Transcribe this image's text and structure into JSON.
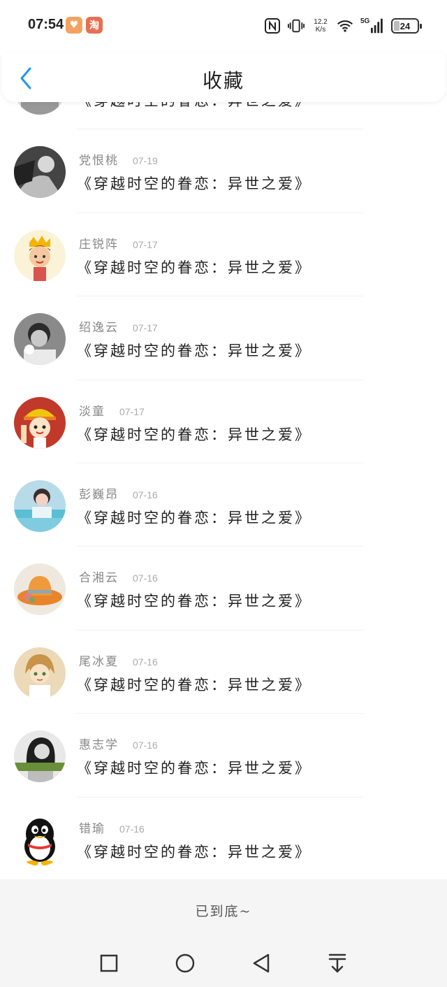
{
  "status_bar": {
    "time": "07:54",
    "app_badges": [
      "heart-app-icon",
      "taobao-icon"
    ],
    "taobao_char": "淘",
    "network_speed_value": "12.2",
    "network_speed_unit": "K/s",
    "network_type": "5G",
    "battery_level": "24",
    "battery_fill_percent": 24
  },
  "header": {
    "title": "收藏",
    "back_icon": "chevron-left-icon",
    "accent_color": "#2196f3"
  },
  "favorites": [
    {
      "author": "",
      "date": "",
      "title": "《穿越时空的眷恋：异世之爱》"
    },
    {
      "author": "党恨桃",
      "date": "07-19",
      "title": "《穿越时空的眷恋：异世之爱》"
    },
    {
      "author": "庄锐阵",
      "date": "07-17",
      "title": "《穿越时空的眷恋：异世之爱》"
    },
    {
      "author": "绍逸云",
      "date": "07-17",
      "title": "《穿越时空的眷恋：异世之爱》"
    },
    {
      "author": "淡童",
      "date": "07-17",
      "title": "《穿越时空的眷恋：异世之爱》"
    },
    {
      "author": "彭巍昂",
      "date": "07-16",
      "title": "《穿越时空的眷恋：异世之爱》"
    },
    {
      "author": "合湘云",
      "date": "07-16",
      "title": "《穿越时空的眷恋：异世之爱》"
    },
    {
      "author": "尾冰夏",
      "date": "07-16",
      "title": "《穿越时空的眷恋：异世之爱》"
    },
    {
      "author": "惠志学",
      "date": "07-16",
      "title": "《穿越时空的眷恋：异世之爱》"
    },
    {
      "author": "错瑜",
      "date": "07-16",
      "title": "《穿越时空的眷恋：异世之爱》"
    }
  ],
  "footer": {
    "end_text": "已到底~"
  },
  "nav_bar": {
    "buttons": [
      "recent-apps-icon",
      "home-icon",
      "back-triangle-icon",
      "notification-pull-icon"
    ]
  }
}
